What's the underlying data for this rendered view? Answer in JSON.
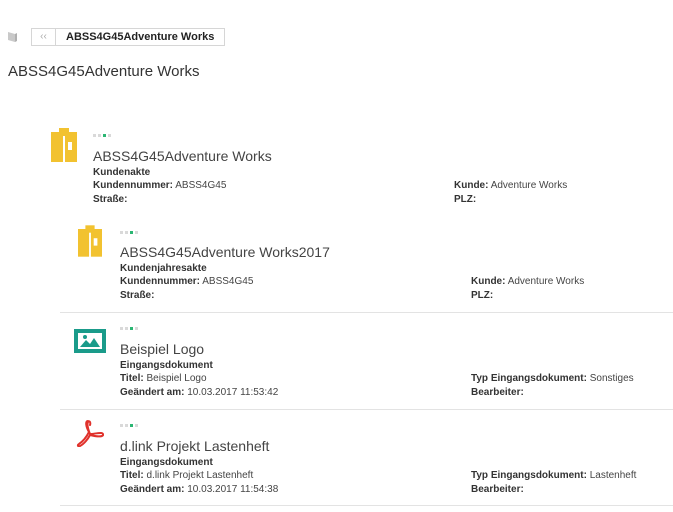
{
  "breadcrumb": {
    "back_glyph": "‹‹",
    "current": "ABSS4G45Adventure Works"
  },
  "page": {
    "title": "ABSS4G45Adventure Works"
  },
  "items": [
    {
      "title": "ABSS4G45Adventure Works",
      "type": "Kundenakte",
      "icon": "folder-icon",
      "fields_left": [
        {
          "label": "Kundennummer:",
          "value": "ABSS4G45"
        },
        {
          "label": "Straße:",
          "value": ""
        }
      ],
      "fields_right": [
        {
          "label": "Kunde:",
          "value": "Adventure Works"
        },
        {
          "label": "PLZ:",
          "value": ""
        }
      ]
    },
    {
      "title": "ABSS4G45Adventure Works2017",
      "type": "Kundenjahresakte",
      "icon": "folder-icon",
      "fields_left": [
        {
          "label": "Kundennummer:",
          "value": "ABSS4G45"
        },
        {
          "label": "Straße:",
          "value": ""
        }
      ],
      "fields_right": [
        {
          "label": "Kunde:",
          "value": "Adventure Works"
        },
        {
          "label": "PLZ:",
          "value": ""
        }
      ]
    },
    {
      "title": "Beispiel Logo",
      "type": "Eingangsdokument",
      "icon": "image-icon",
      "fields_left": [
        {
          "label": "Titel:",
          "value": "Beispiel Logo"
        },
        {
          "label": "Geändert am:",
          "value": "10.03.2017 11:53:42"
        }
      ],
      "fields_right": [
        {
          "label": "Typ Eingangsdokument:",
          "value": "Sonstiges"
        },
        {
          "label": "Bearbeiter:",
          "value": ""
        }
      ]
    },
    {
      "title": "d.link Projekt Lastenheft",
      "type": "Eingangsdokument",
      "icon": "pdf-icon",
      "fields_left": [
        {
          "label": "Titel:",
          "value": "d.link Projekt Lastenheft"
        },
        {
          "label": "Geändert am:",
          "value": "10.03.2017 11:54:38"
        }
      ],
      "fields_right": [
        {
          "label": "Typ Eingangsdokument:",
          "value": "Lastenheft"
        },
        {
          "label": "Bearbeiter:",
          "value": ""
        }
      ]
    }
  ],
  "colors": {
    "folder": "#f2c230",
    "image": "#1a9b8a",
    "pdf": "#e0312b",
    "accent_dot": "#2bb673"
  }
}
